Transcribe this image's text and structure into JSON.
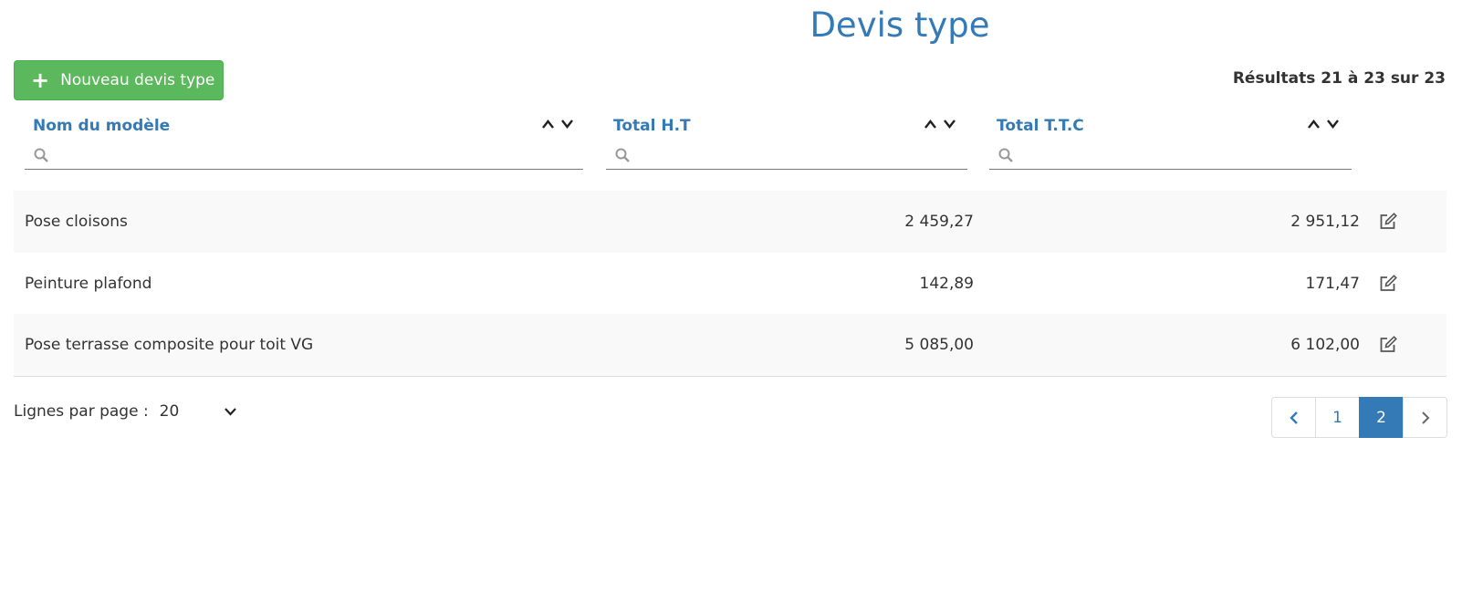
{
  "page": {
    "title": "Devis type"
  },
  "toolbar": {
    "new_label": "Nouveau devis type",
    "results": "Résultats 21 à 23 sur 23"
  },
  "columns": [
    {
      "label": "Nom du modèle",
      "filter_value": ""
    },
    {
      "label": "Total H.T",
      "filter_value": ""
    },
    {
      "label": "Total T.T.C",
      "filter_value": ""
    }
  ],
  "rows": [
    {
      "name": "Pose cloisons",
      "ht": "2 459,27",
      "ttc": "2 951,12"
    },
    {
      "name": "Peinture plafond",
      "ht": "142,89",
      "ttc": "171,47"
    },
    {
      "name": "Pose terrasse composite pour toit VG",
      "ht": "5 085,00",
      "ttc": "6 102,00"
    }
  ],
  "footer": {
    "per_page_label": "Lignes par page :",
    "per_page_value": "20"
  },
  "pagination": {
    "pages": [
      "1",
      "2"
    ],
    "current": "2"
  },
  "colors": {
    "accent": "#337ab7",
    "success": "#5cb85c"
  }
}
